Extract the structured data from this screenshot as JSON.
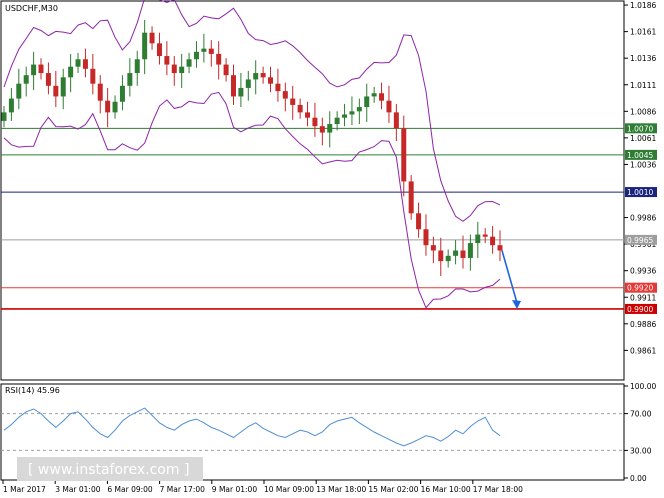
{
  "chart_data": [
    {
      "type": "candlestick",
      "title": "USDCHF,M30",
      "y_ticks": [
        "1.0186",
        "1.0161",
        "1.0136",
        "1.0111",
        "1.0086",
        "1.0061",
        "1.0036",
        "0.9986",
        "0.9961",
        "0.9936",
        "0.9911",
        "0.9886",
        "0.9861"
      ],
      "ylim": [
        0.9835,
        1.0187
      ],
      "x_ticks": [
        "1 Mar 2017",
        "3 Mar 01:00",
        "6 Mar 09:00",
        "7 Mar 17:00",
        "9 Mar 01:00",
        "10 Mar 09:00",
        "13 Mar 18:00",
        "15 Mar 02:00",
        "16 Mar 10:00",
        "17 Mar 18:00"
      ],
      "series": [
        {
          "values": [
            1.0085,
            1.0098,
            1.0112,
            1.012,
            1.013,
            1.0122,
            1.011,
            1.01,
            1.0118,
            1.0128,
            1.0135,
            1.0126,
            1.0112,
            1.0096,
            1.0085,
            1.0095,
            1.011,
            1.0122,
            1.0135,
            1.016,
            1.015,
            1.0138,
            1.013,
            1.0122,
            1.0128,
            1.0135,
            1.0142,
            1.0145,
            1.014,
            1.013,
            1.012,
            1.01,
            1.0108,
            1.0116,
            1.0122,
            1.0118,
            1.0112,
            1.0105,
            1.0098,
            1.0092,
            1.0085,
            1.008,
            1.0072,
            1.0066,
            1.0074,
            1.008,
            1.0083,
            1.0086,
            1.009,
            1.01,
            1.0103,
            1.0096,
            1.0085,
            1.007,
            1.002,
            0.999,
            0.9975,
            0.996,
            0.9955,
            0.9945,
            0.995,
            0.9955,
            0.9948,
            0.9962,
            0.997,
            0.9968,
            0.996,
            0.9955
          ]
        },
        {
          "name": "RSI(14)",
          "values": [
            52,
            58,
            66,
            72,
            75,
            70,
            62,
            55,
            62,
            70,
            72,
            64,
            55,
            48,
            44,
            52,
            62,
            68,
            72,
            76,
            68,
            60,
            55,
            52,
            58,
            62,
            64,
            60,
            55,
            52,
            48,
            44,
            50,
            56,
            60,
            54,
            50,
            46,
            44,
            48,
            52,
            50,
            46,
            50,
            58,
            62,
            64,
            66,
            60,
            55,
            50,
            46,
            42,
            38,
            35,
            38,
            42,
            46,
            44,
            40,
            45,
            52,
            48,
            56,
            62,
            66,
            52,
            45.96
          ]
        }
      ],
      "levels": [
        {
          "value": "1.0070",
          "color": "#2e7d32"
        },
        {
          "value": "1.0045",
          "color": "#2e7d32"
        },
        {
          "value": "1.0010",
          "color": "#1a237e"
        },
        {
          "value": "0.9965",
          "color": "#9e9e9e"
        },
        {
          "value": "0.9920",
          "color": "#e53935"
        },
        {
          "value": "0.9900",
          "color": "#cc0000"
        }
      ],
      "rsi_label": "RSI(14) 45.96",
      "rsi_ticks": [
        "100.00",
        "70.00",
        "30.00",
        "0.00"
      ],
      "rsi_ylim": [
        0,
        100
      ],
      "colors": {
        "bull": "#2e7d32",
        "bear": "#c62828",
        "band": "#8e24aa",
        "rsi": "#4f8fd6",
        "arrow": "#1e64dc"
      }
    }
  ],
  "watermark": "[ www.instaforex.com ]"
}
